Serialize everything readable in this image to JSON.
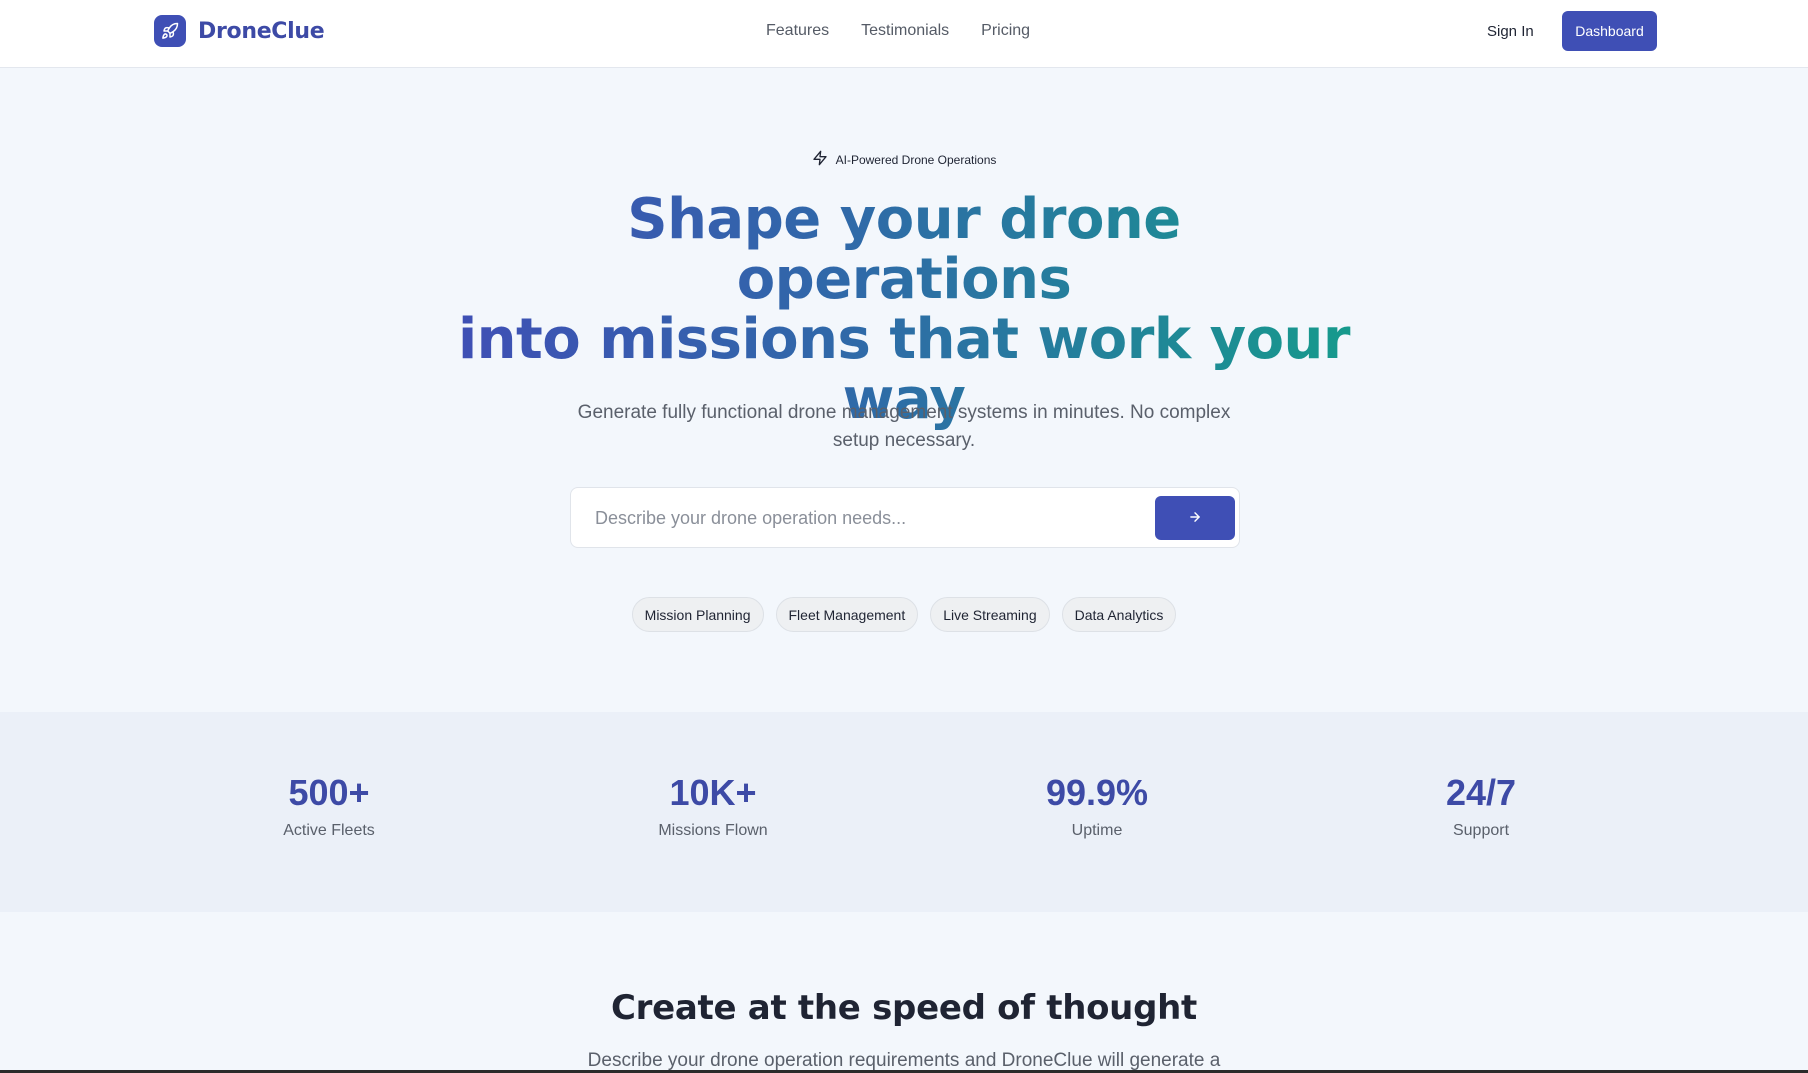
{
  "brand": {
    "name": "DroneClue",
    "logo_icon": "rocket-icon"
  },
  "nav": {
    "links": [
      "Features",
      "Testimonials",
      "Pricing"
    ],
    "sign_in": "Sign In",
    "dashboard": "Dashboard"
  },
  "hero": {
    "badge": "AI-Powered Drone Operations",
    "badge_icon": "lightning-icon",
    "headline_line1": "Shape your drone operations",
    "headline_line2": "into missions that work your",
    "headline_line3": "way",
    "subhead": "Generate fully functional drone management systems in minutes. No complex setup necessary.",
    "search_placeholder": "Describe your drone operation needs...",
    "search_value": "",
    "submit_icon": "arrow-right-icon",
    "chips": [
      "Mission Planning",
      "Fleet Management",
      "Live Streaming",
      "Data Analytics"
    ]
  },
  "stats": [
    {
      "value": "500+",
      "label": "Active Fleets"
    },
    {
      "value": "10K+",
      "label": "Missions Flown"
    },
    {
      "value": "99.9%",
      "label": "Uptime"
    },
    {
      "value": "24/7",
      "label": "Support"
    }
  ],
  "section": {
    "title": "Create at the speed of thought",
    "desc": "Describe your drone operation requirements and DroneClue will generate a"
  },
  "colors": {
    "primary": "#3f4fb5",
    "accent": "#169a8c",
    "background": "#f3f7fc"
  }
}
